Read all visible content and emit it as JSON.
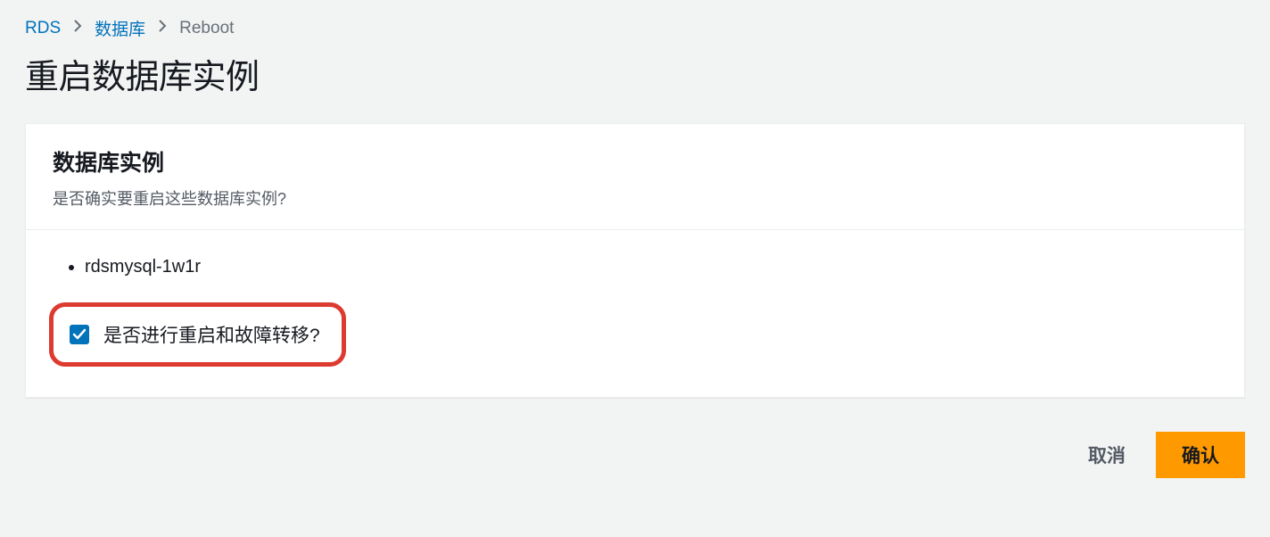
{
  "breadcrumb": {
    "items": [
      {
        "label": "RDS"
      },
      {
        "label": "数据库"
      },
      {
        "label": "Reboot"
      }
    ]
  },
  "page": {
    "title": "重启数据库实例"
  },
  "panel": {
    "title": "数据库实例",
    "subtitle": "是否确实要重启这些数据库实例?"
  },
  "instances": [
    "rdsmysql-1w1r"
  ],
  "failover": {
    "label": "是否进行重启和故障转移?",
    "checked": true
  },
  "actions": {
    "cancel": "取消",
    "confirm": "确认"
  }
}
